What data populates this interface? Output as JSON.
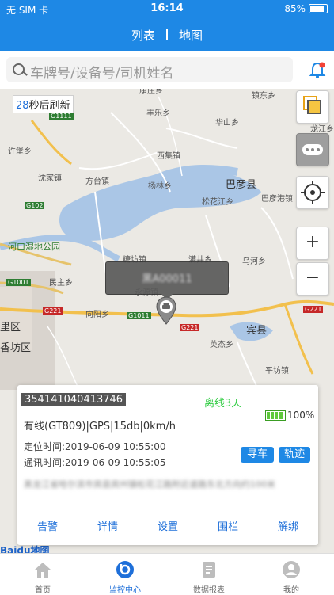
{
  "status_bar": {
    "carrier": "无 SIM 卡",
    "time": "16:14",
    "battery": "85%"
  },
  "nav": {
    "list_tab": "列表",
    "map_tab": "地图"
  },
  "search": {
    "placeholder": "车牌号/设备号/司机姓名"
  },
  "map": {
    "refresh_seconds": "28",
    "refresh_text": "秒后刷新",
    "places": {
      "kangzhuang": "康庄乡",
      "zhenan": "镇东乡",
      "fengle": "丰乐乡",
      "huashan": "华山乡",
      "longjiang": "龙江乡",
      "xujia": "许堡乡",
      "xiji": "西集镇",
      "shajia": "沈家镇",
      "fangtai": "方台镇",
      "yanglin": "杨林乡",
      "bayan": "巴彦县",
      "songhuajiang": "松花江乡",
      "bayangang": "巴彦港镇",
      "hekou": "河口湿地公园",
      "tangfang": "糖坊镇",
      "manjing": "满井乡",
      "wuhe": "乌河乡",
      "minzhu": "民主乡",
      "yongyuan": "永源镇",
      "xiangyang": "向阳乡",
      "binxian": "宾县",
      "yingjie": "英杰乡",
      "pingshan": "平坊镇",
      "lixiang": "里区",
      "xiangfang": "香坊区"
    },
    "roads": {
      "g1111": "G1111",
      "g102": "G102",
      "g1001": "G1001",
      "g1011": "G1011",
      "g221a": "G221",
      "g221b": "G221",
      "g221c": "G221"
    },
    "vehicle_tooltip": "黑A00011"
  },
  "card": {
    "imei": "354141040413746",
    "status": "离线3天",
    "info": "有线(GT809)|GPS|15db|0km/h",
    "battery": "100%",
    "locate_time": "定位时间:2019-06-09 10:55:00",
    "comm_time": "通讯时间:2019-06-09 10:55:05",
    "find_car": "寻车",
    "track": "轨迹",
    "address": "黑龙江省哈尔滨市宾县宾州镇松花江路附近道路东北方向约100米",
    "actions": [
      "告警",
      "详情",
      "设置",
      "围栏",
      "解绑"
    ]
  },
  "baidu_logo": "Baidu地图",
  "tabs": [
    "首页",
    "监控中心",
    "数据报表",
    "我的"
  ],
  "colors": {
    "primary": "#1e88e5",
    "link": "#1e6fd9",
    "offline": "#2ecc40"
  }
}
